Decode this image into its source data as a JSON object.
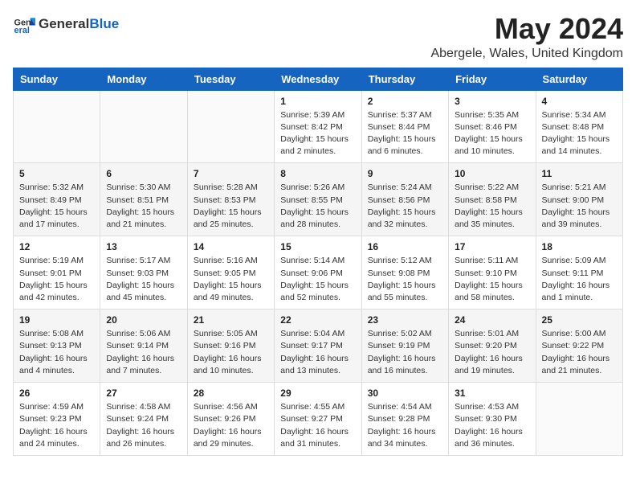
{
  "header": {
    "logo_general": "General",
    "logo_blue": "Blue",
    "title": "May 2024",
    "subtitle": "Abergele, Wales, United Kingdom"
  },
  "weekdays": [
    "Sunday",
    "Monday",
    "Tuesday",
    "Wednesday",
    "Thursday",
    "Friday",
    "Saturday"
  ],
  "weeks": [
    [
      {
        "day": "",
        "info": ""
      },
      {
        "day": "",
        "info": ""
      },
      {
        "day": "",
        "info": ""
      },
      {
        "day": "1",
        "info": "Sunrise: 5:39 AM\nSunset: 8:42 PM\nDaylight: 15 hours\nand 2 minutes."
      },
      {
        "day": "2",
        "info": "Sunrise: 5:37 AM\nSunset: 8:44 PM\nDaylight: 15 hours\nand 6 minutes."
      },
      {
        "day": "3",
        "info": "Sunrise: 5:35 AM\nSunset: 8:46 PM\nDaylight: 15 hours\nand 10 minutes."
      },
      {
        "day": "4",
        "info": "Sunrise: 5:34 AM\nSunset: 8:48 PM\nDaylight: 15 hours\nand 14 minutes."
      }
    ],
    [
      {
        "day": "5",
        "info": "Sunrise: 5:32 AM\nSunset: 8:49 PM\nDaylight: 15 hours\nand 17 minutes."
      },
      {
        "day": "6",
        "info": "Sunrise: 5:30 AM\nSunset: 8:51 PM\nDaylight: 15 hours\nand 21 minutes."
      },
      {
        "day": "7",
        "info": "Sunrise: 5:28 AM\nSunset: 8:53 PM\nDaylight: 15 hours\nand 25 minutes."
      },
      {
        "day": "8",
        "info": "Sunrise: 5:26 AM\nSunset: 8:55 PM\nDaylight: 15 hours\nand 28 minutes."
      },
      {
        "day": "9",
        "info": "Sunrise: 5:24 AM\nSunset: 8:56 PM\nDaylight: 15 hours\nand 32 minutes."
      },
      {
        "day": "10",
        "info": "Sunrise: 5:22 AM\nSunset: 8:58 PM\nDaylight: 15 hours\nand 35 minutes."
      },
      {
        "day": "11",
        "info": "Sunrise: 5:21 AM\nSunset: 9:00 PM\nDaylight: 15 hours\nand 39 minutes."
      }
    ],
    [
      {
        "day": "12",
        "info": "Sunrise: 5:19 AM\nSunset: 9:01 PM\nDaylight: 15 hours\nand 42 minutes."
      },
      {
        "day": "13",
        "info": "Sunrise: 5:17 AM\nSunset: 9:03 PM\nDaylight: 15 hours\nand 45 minutes."
      },
      {
        "day": "14",
        "info": "Sunrise: 5:16 AM\nSunset: 9:05 PM\nDaylight: 15 hours\nand 49 minutes."
      },
      {
        "day": "15",
        "info": "Sunrise: 5:14 AM\nSunset: 9:06 PM\nDaylight: 15 hours\nand 52 minutes."
      },
      {
        "day": "16",
        "info": "Sunrise: 5:12 AM\nSunset: 9:08 PM\nDaylight: 15 hours\nand 55 minutes."
      },
      {
        "day": "17",
        "info": "Sunrise: 5:11 AM\nSunset: 9:10 PM\nDaylight: 15 hours\nand 58 minutes."
      },
      {
        "day": "18",
        "info": "Sunrise: 5:09 AM\nSunset: 9:11 PM\nDaylight: 16 hours\nand 1 minute."
      }
    ],
    [
      {
        "day": "19",
        "info": "Sunrise: 5:08 AM\nSunset: 9:13 PM\nDaylight: 16 hours\nand 4 minutes."
      },
      {
        "day": "20",
        "info": "Sunrise: 5:06 AM\nSunset: 9:14 PM\nDaylight: 16 hours\nand 7 minutes."
      },
      {
        "day": "21",
        "info": "Sunrise: 5:05 AM\nSunset: 9:16 PM\nDaylight: 16 hours\nand 10 minutes."
      },
      {
        "day": "22",
        "info": "Sunrise: 5:04 AM\nSunset: 9:17 PM\nDaylight: 16 hours\nand 13 minutes."
      },
      {
        "day": "23",
        "info": "Sunrise: 5:02 AM\nSunset: 9:19 PM\nDaylight: 16 hours\nand 16 minutes."
      },
      {
        "day": "24",
        "info": "Sunrise: 5:01 AM\nSunset: 9:20 PM\nDaylight: 16 hours\nand 19 minutes."
      },
      {
        "day": "25",
        "info": "Sunrise: 5:00 AM\nSunset: 9:22 PM\nDaylight: 16 hours\nand 21 minutes."
      }
    ],
    [
      {
        "day": "26",
        "info": "Sunrise: 4:59 AM\nSunset: 9:23 PM\nDaylight: 16 hours\nand 24 minutes."
      },
      {
        "day": "27",
        "info": "Sunrise: 4:58 AM\nSunset: 9:24 PM\nDaylight: 16 hours\nand 26 minutes."
      },
      {
        "day": "28",
        "info": "Sunrise: 4:56 AM\nSunset: 9:26 PM\nDaylight: 16 hours\nand 29 minutes."
      },
      {
        "day": "29",
        "info": "Sunrise: 4:55 AM\nSunset: 9:27 PM\nDaylight: 16 hours\nand 31 minutes."
      },
      {
        "day": "30",
        "info": "Sunrise: 4:54 AM\nSunset: 9:28 PM\nDaylight: 16 hours\nand 34 minutes."
      },
      {
        "day": "31",
        "info": "Sunrise: 4:53 AM\nSunset: 9:30 PM\nDaylight: 16 hours\nand 36 minutes."
      },
      {
        "day": "",
        "info": ""
      }
    ]
  ]
}
